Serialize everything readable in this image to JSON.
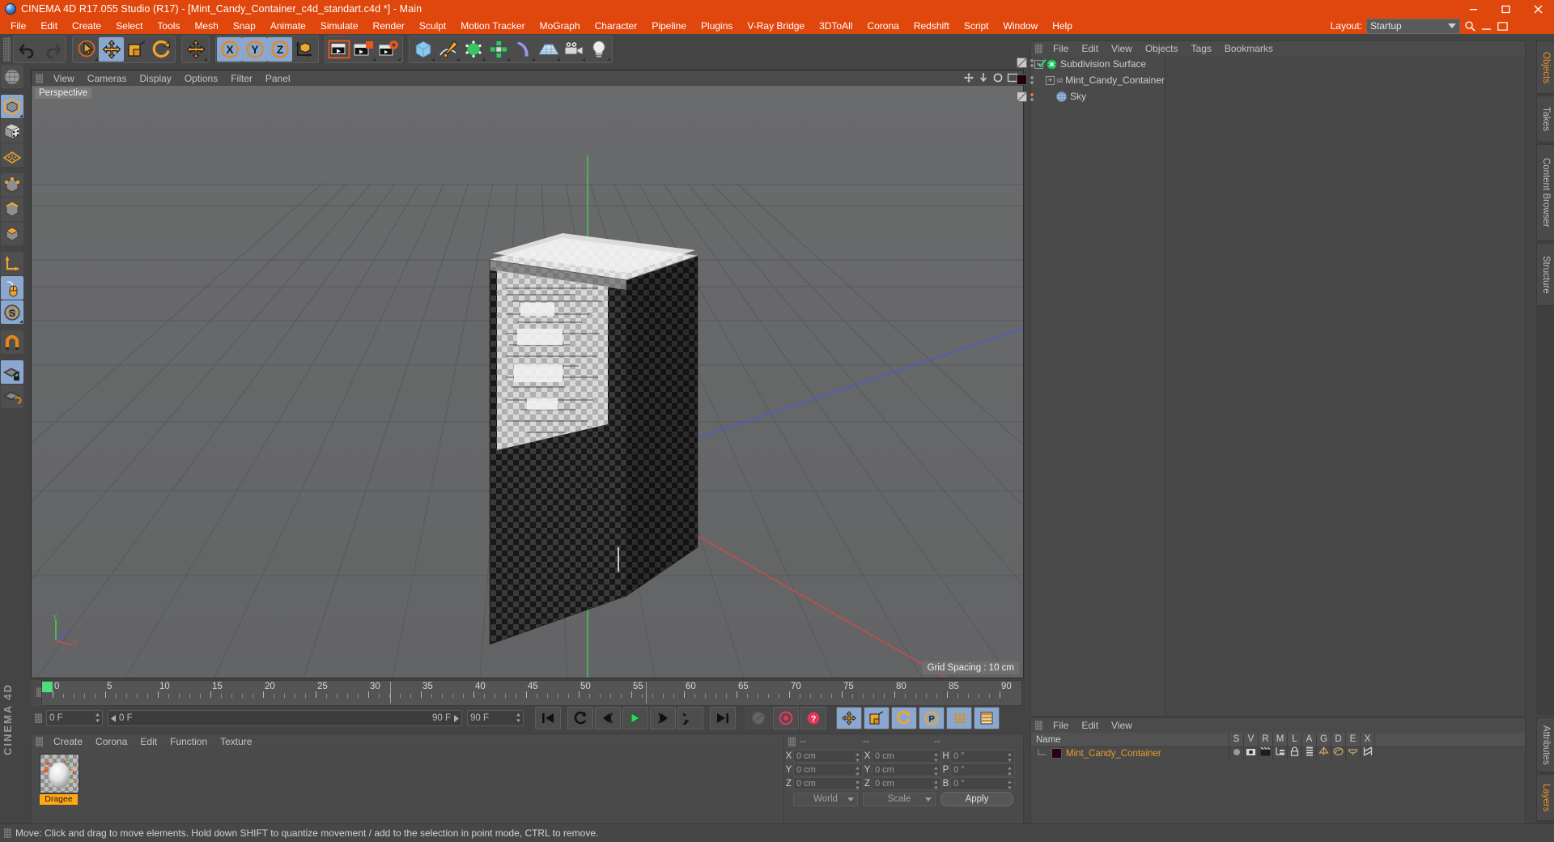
{
  "window": {
    "title": "CINEMA 4D R17.055 Studio (R17) - [Mint_Candy_Container_c4d_standart.c4d *] - Main",
    "minimize": "–",
    "maximize": "❐",
    "close": "✕"
  },
  "menubar": {
    "items": [
      "File",
      "Edit",
      "Create",
      "Select",
      "Tools",
      "Mesh",
      "Snap",
      "Animate",
      "Simulate",
      "Render",
      "Sculpt",
      "Motion Tracker",
      "MoGraph",
      "Character",
      "Pipeline",
      "Plugins",
      "V-Ray Bridge",
      "3DToAll",
      "Corona",
      "Redshift",
      "Script",
      "Window",
      "Help"
    ],
    "layout_label": "Layout:",
    "layout_value": "Startup"
  },
  "toolbar": {
    "groups": [
      {
        "name": "history",
        "buttons": [
          {
            "name": "undo-button",
            "icon": "undo",
            "active": false,
            "dim": false
          },
          {
            "name": "redo-button",
            "icon": "redo",
            "active": false,
            "dim": true
          }
        ]
      },
      {
        "name": "transform",
        "buttons": [
          {
            "name": "select-tool",
            "icon": "select",
            "active": false,
            "dim": false,
            "corner": true
          },
          {
            "name": "move-tool",
            "icon": "move",
            "active": true,
            "dim": false
          },
          {
            "name": "scale-tool",
            "icon": "scale",
            "active": false,
            "dim": false
          },
          {
            "name": "rotate-tool",
            "icon": "rotate",
            "active": false,
            "dim": false
          }
        ]
      },
      {
        "name": "move-standalone",
        "buttons": [
          {
            "name": "move-tool-alt",
            "icon": "move",
            "active": false,
            "dim": false,
            "corner": true
          }
        ]
      },
      {
        "name": "axis-locks",
        "buttons": [
          {
            "name": "x-axis-lock",
            "icon": "x",
            "active": true,
            "dim": false
          },
          {
            "name": "y-axis-lock",
            "icon": "y",
            "active": true,
            "dim": false
          },
          {
            "name": "z-axis-lock",
            "icon": "z",
            "active": true,
            "dim": false
          },
          {
            "name": "world-axis-toggle",
            "icon": "worldaxis",
            "active": false,
            "dim": false
          }
        ]
      },
      {
        "name": "render",
        "buttons": [
          {
            "name": "render-view-button",
            "icon": "render-view",
            "active": false,
            "dim": false
          },
          {
            "name": "render-to-picture-viewer-button",
            "icon": "render-picture",
            "active": false,
            "dim": false,
            "corner": true
          },
          {
            "name": "render-settings-button",
            "icon": "render-settings",
            "active": false,
            "dim": false,
            "corner": true
          }
        ]
      },
      {
        "name": "create",
        "buttons": [
          {
            "name": "add-cube-button",
            "icon": "cube",
            "active": false,
            "dim": false,
            "corner": true
          },
          {
            "name": "add-spline-button",
            "icon": "spline",
            "active": false,
            "dim": false,
            "corner": true
          },
          {
            "name": "add-generator-button",
            "icon": "generator",
            "active": false,
            "dim": false,
            "corner": true
          },
          {
            "name": "add-deformer-button",
            "icon": "deformer",
            "active": false,
            "dim": false,
            "corner": true
          },
          {
            "name": "add-bend-button",
            "icon": "bend",
            "active": false,
            "dim": false,
            "corner": true
          },
          {
            "name": "add-floor-button",
            "icon": "floor",
            "active": false,
            "dim": false,
            "corner": true
          },
          {
            "name": "add-camera-button",
            "icon": "camera",
            "active": false,
            "dim": false,
            "corner": true
          },
          {
            "name": "add-light-button",
            "icon": "light",
            "active": false,
            "dim": false,
            "corner": true
          }
        ]
      }
    ]
  },
  "left_tools": [
    {
      "name": "globe-tool",
      "icon": "globe",
      "active": false
    },
    {
      "sep": true
    },
    {
      "name": "model-mode-tool",
      "icon": "cube-orange",
      "active": true,
      "corner": true
    },
    {
      "name": "texture-mode-tool",
      "icon": "cube-checker",
      "active": false
    },
    {
      "name": "workplane-tool",
      "icon": "grid-orange",
      "active": false
    },
    {
      "sep": true
    },
    {
      "name": "points-mode-tool",
      "icon": "cube-points",
      "active": false
    },
    {
      "name": "edges-mode-tool",
      "icon": "cube-edges",
      "active": false
    },
    {
      "name": "polygons-mode-tool",
      "icon": "cube-poly",
      "active": false
    },
    {
      "sep": true
    },
    {
      "name": "axis-mode-tool",
      "icon": "axis",
      "active": false
    },
    {
      "name": "enable-tweak-tool",
      "icon": "mouse",
      "active": true
    },
    {
      "name": "soft-selection-tool",
      "icon": "soft-s",
      "active": true,
      "corner": true
    },
    {
      "sep": true
    },
    {
      "name": "snap-tool",
      "icon": "magnet",
      "active": false
    },
    {
      "sep": true
    },
    {
      "name": "lock-workplane-tool",
      "icon": "plane-lock",
      "active": true
    },
    {
      "name": "workplane-align-tool",
      "icon": "plane-rotate",
      "active": false
    }
  ],
  "brand": "CINEMA 4D",
  "viewport": {
    "menu": [
      "View",
      "Cameras",
      "Display",
      "Options",
      "Filter",
      "Panel"
    ],
    "label": "Perspective",
    "grid_spacing": "Grid Spacing : 10 cm",
    "axis": {
      "y": "Y",
      "z": "Z",
      "x": "X"
    }
  },
  "timeline": {
    "ticks": [
      0,
      5,
      10,
      15,
      20,
      25,
      30,
      35,
      40,
      45,
      50,
      55,
      60,
      65,
      70,
      75,
      80,
      85,
      90
    ],
    "min": 0,
    "max": 90,
    "current_frame": "0 F",
    "range_start": "0 F",
    "range_end": "90 F",
    "end_frame": "90 F"
  },
  "transport": {
    "buttons": [
      {
        "name": "go-to-start-button",
        "icon": "skip-start"
      },
      {
        "name": "play-backward-keyframe-button",
        "icon": "prev-key"
      },
      {
        "name": "step-back-button",
        "icon": "step-back"
      },
      {
        "name": "play-button",
        "icon": "play"
      },
      {
        "name": "step-forward-button",
        "icon": "step-fwd"
      },
      {
        "name": "next-keyframe-button",
        "icon": "next-key"
      },
      {
        "name": "go-to-end-button",
        "icon": "skip-end"
      },
      {
        "name": "record-active-objects-button",
        "icon": "record-dim"
      },
      {
        "name": "autokeying-button",
        "icon": "autokey"
      },
      {
        "name": "keyframe-selection-button",
        "icon": "keyselect"
      },
      {
        "name": "position-key-button",
        "icon": "pos-key",
        "blue": true
      },
      {
        "name": "scale-key-button",
        "icon": "scale-key",
        "blue": true
      },
      {
        "name": "rotation-key-button",
        "icon": "rot-key",
        "blue": true
      },
      {
        "name": "pla-key-button",
        "icon": "pla-key",
        "blue": true
      },
      {
        "name": "parameter-key-button",
        "icon": "param-key",
        "blue": true
      },
      {
        "name": "animation-layers-button",
        "icon": "anim-layers",
        "blue": true
      }
    ]
  },
  "material_manager": {
    "menu": [
      "Create",
      "Corona",
      "Edit",
      "Function",
      "Texture"
    ],
    "materials": [
      {
        "name": "Dragee"
      }
    ]
  },
  "object_manager": {
    "menu": [
      "File",
      "Edit",
      "View",
      "Objects",
      "Tags",
      "Bookmarks"
    ],
    "objects": [
      {
        "name": "Subdivision Surface",
        "depth": 0,
        "icon": "subdivision",
        "expander": "-",
        "tag_color": "#d4d4d4",
        "dot_state": "check"
      },
      {
        "name": "Mint_Candy_Container",
        "depth": 1,
        "icon": "object-null",
        "expander": "+",
        "tag_color": "#220016",
        "dot_state": "none"
      },
      {
        "name": "Sky",
        "depth": 1,
        "icon": "sky",
        "expander": "",
        "tag_color": "#d4d4d4",
        "dot_state": "red"
      }
    ]
  },
  "layer_manager": {
    "menu": [
      "File",
      "Edit",
      "View"
    ],
    "columns": [
      "Name",
      "S",
      "V",
      "R",
      "M",
      "L",
      "A",
      "G",
      "D",
      "E",
      "X"
    ],
    "rows": [
      {
        "name": "Mint_Candy_Container",
        "color": "#e79c28",
        "swatch": "#2b0018"
      }
    ]
  },
  "coordinates": {
    "headers": [
      "--",
      "--",
      "--"
    ],
    "rows": [
      {
        "label1": "X",
        "value1": "0 cm",
        "label2": "X",
        "value2": "0 cm",
        "label3": "H",
        "value3": "0 °"
      },
      {
        "label1": "Y",
        "value1": "0 cm",
        "label2": "Y",
        "value2": "0 cm",
        "label3": "P",
        "value3": "0 °"
      },
      {
        "label1": "Z",
        "value1": "0 cm",
        "label2": "Z",
        "value2": "0 cm",
        "label3": "B",
        "value3": "0 °"
      }
    ],
    "system": "World",
    "mode": "Scale",
    "apply": "Apply"
  },
  "side_tabs_top": [
    {
      "label": "Objects",
      "active": true
    },
    {
      "label": "Takes",
      "active": false
    },
    {
      "label": "Content Browser",
      "active": false
    },
    {
      "label": "Structure",
      "active": false
    }
  ],
  "side_tabs_bottom": [
    {
      "label": "Attributes",
      "active": false
    },
    {
      "label": "Layers",
      "active": true
    }
  ],
  "statusbar": {
    "text": "Move: Click and drag to move elements. Hold down SHIFT to quantize movement / add to the selection in point mode, CTRL to remove."
  }
}
